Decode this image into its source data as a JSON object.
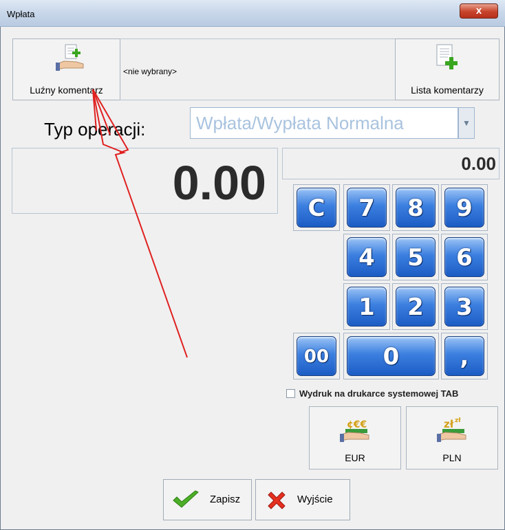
{
  "window": {
    "title": "Wpłata",
    "close_label": "x"
  },
  "toolbar": {
    "loose_comment_label": "Luźny komentarz",
    "selected_comment": "<nie wybrany>",
    "comment_list_label": "Lista komentarzy"
  },
  "operation": {
    "label": "Typ operacji:",
    "value": "Wpłata/Wypłata Normalna"
  },
  "amount": {
    "big": "0.00",
    "display": "0.00"
  },
  "keypad": {
    "clear": "C",
    "k7": "7",
    "k8": "8",
    "k9": "9",
    "k4": "4",
    "k5": "5",
    "k6": "6",
    "k1": "1",
    "k2": "2",
    "k3": "3",
    "k00": "00",
    "k0": "0",
    "comma": ","
  },
  "print": {
    "label": "Wydruk na drukarce systemowej TAB",
    "checked": false
  },
  "currency": {
    "eur_label": "EUR",
    "pln_label": "PLN"
  },
  "actions": {
    "save_label": "Zapisz",
    "exit_label": "Wyjście"
  },
  "colors": {
    "accent": "#1c5cc4",
    "annotation": "#e02020"
  }
}
